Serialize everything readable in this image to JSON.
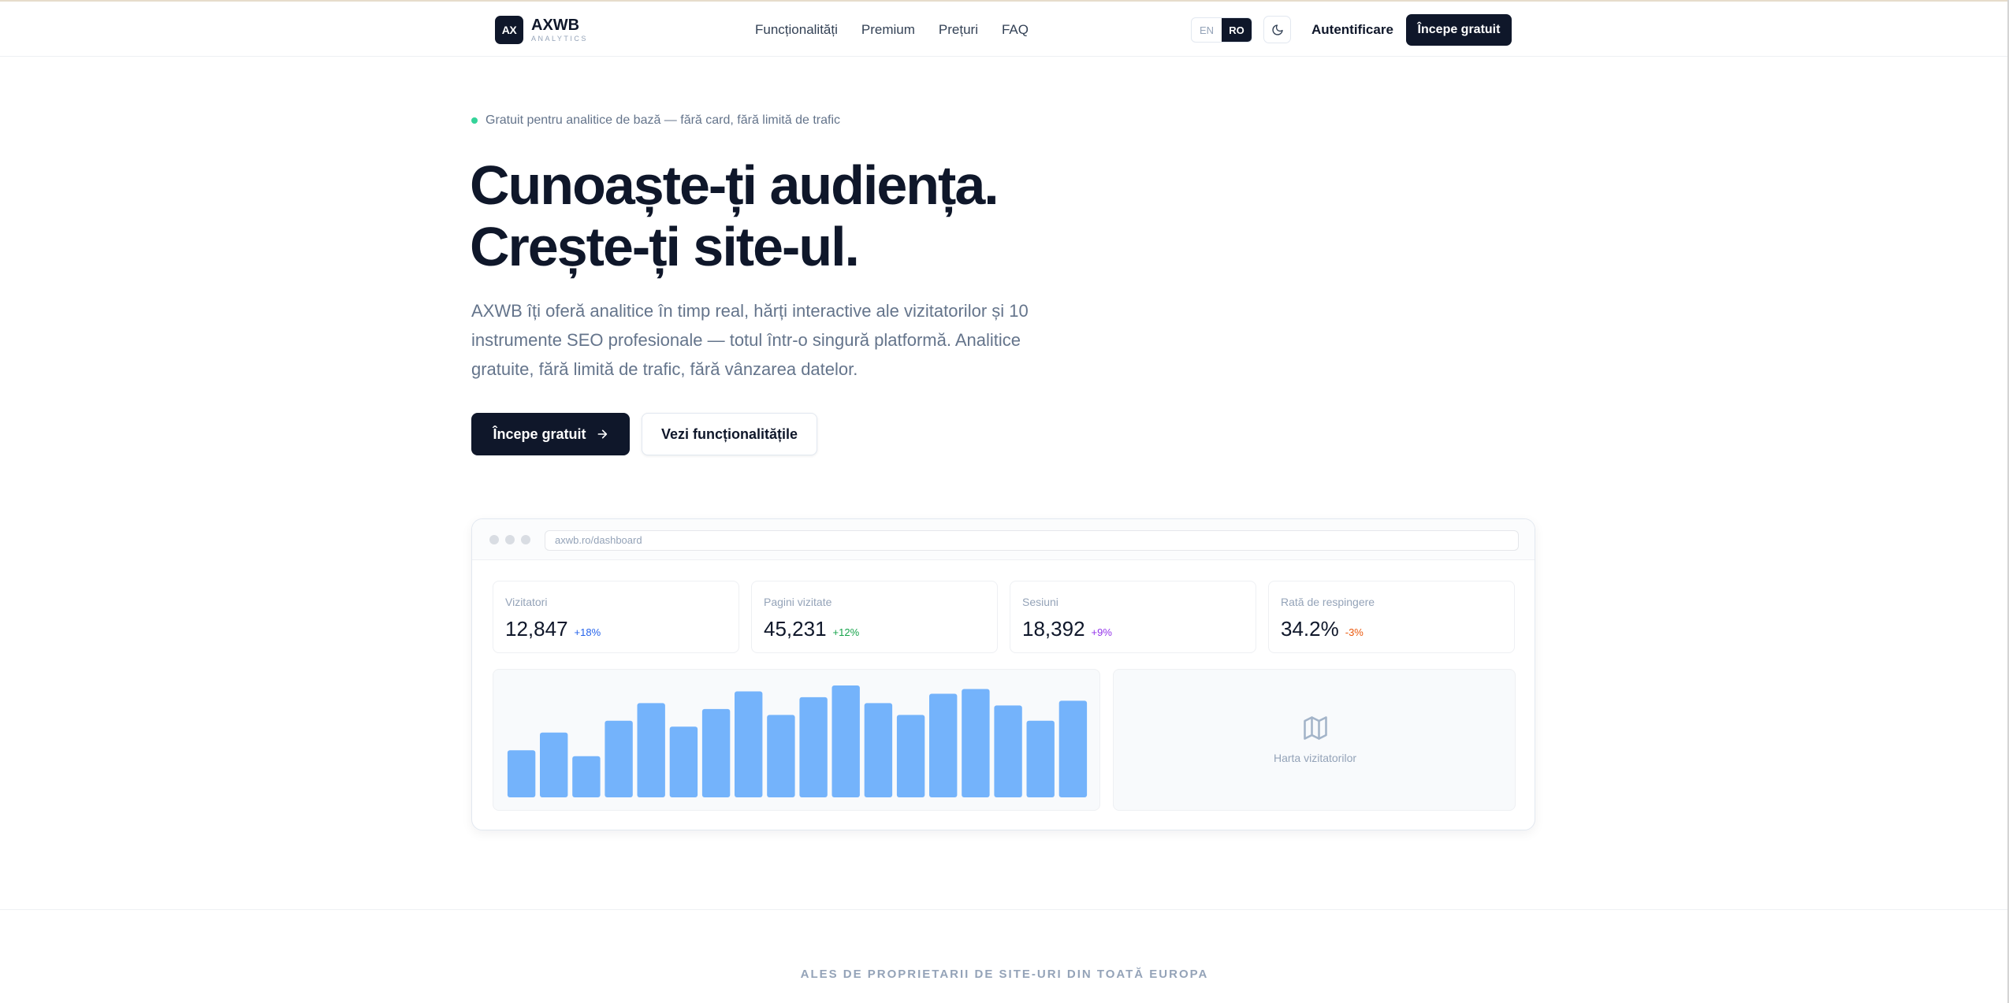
{
  "nav": {
    "logo_mark": "AX",
    "logo_name": "AXWB",
    "logo_sub": "ANALYTICS",
    "links": [
      "Funcționalități",
      "Premium",
      "Prețuri",
      "FAQ"
    ],
    "lang_en": "EN",
    "lang_ro": "RO",
    "active_lang": "RO",
    "theme_icon": "moon-icon",
    "login": "Autentificare",
    "cta": "Începe gratuit"
  },
  "hero": {
    "badge": "Gratuit pentru analitice de bază — fără card, fără limită de trafic",
    "title_line1": "Cunoaște-ți audiența.",
    "title_line2": "Crește-ți site-ul.",
    "description": "AXWB îți oferă analitice în timp real, hărți interactive ale vizitatorilor și 10 instrumente SEO profesionale — totul într-o singură platformă. Analitice gratuite, fără limită de trafic, fără vânzarea datelor.",
    "primary_button": "Începe gratuit",
    "secondary_button": "Vezi funcționalitățile"
  },
  "dashboard": {
    "url": "axwb.ro/dashboard",
    "stats": [
      {
        "label": "Vizitatori",
        "value": "12,847",
        "delta": "+18%",
        "color": "#2563eb"
      },
      {
        "label": "Pagini vizitate",
        "value": "45,231",
        "delta": "+12%",
        "color": "#16a34a"
      },
      {
        "label": "Sesiuni",
        "value": "18,392",
        "delta": "+9%",
        "color": "#9333ea"
      },
      {
        "label": "Rată de respingere",
        "value": "34.2%",
        "delta": "-3%",
        "color": "#ea580c"
      }
    ],
    "map_label": "Harta vizitatorilor",
    "map_icon": "map-icon"
  },
  "chart_data": {
    "type": "bar",
    "values": [
      40,
      55,
      35,
      65,
      80,
      60,
      75,
      90,
      70,
      85,
      95,
      80,
      70,
      88,
      92,
      78,
      65,
      82
    ],
    "bar_color": "#74b3fb"
  },
  "footer": {
    "tagline": "ALES DE PROPRIETARII DE SITE-URI DIN TOATĂ EUROPA"
  },
  "colors": {
    "primary": "#0f172a",
    "accent_green": "#34d399",
    "muted": "#64748b"
  }
}
